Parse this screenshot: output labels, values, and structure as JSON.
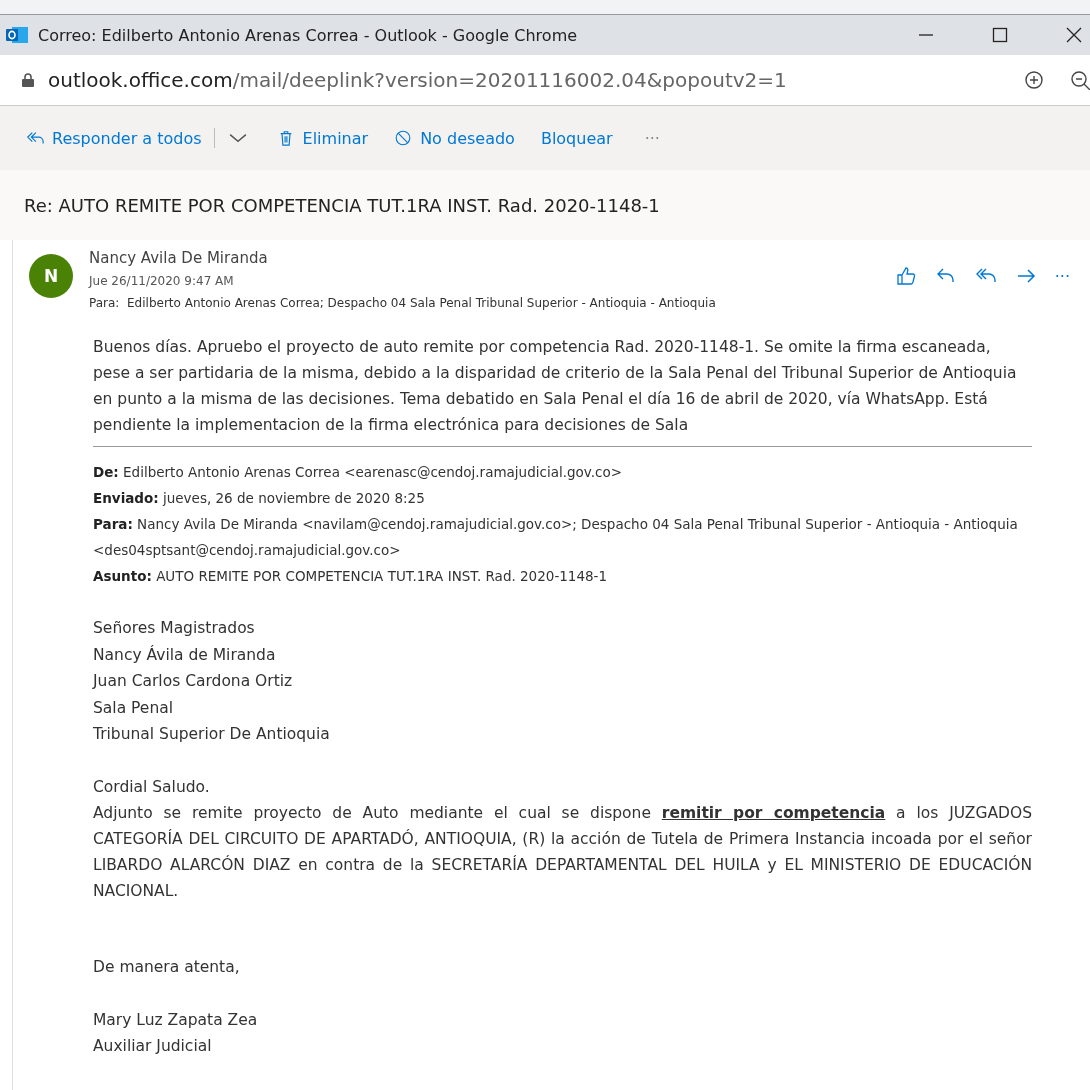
{
  "window": {
    "title": "Correo: Edilberto Antonio Arenas Correa - Outlook - Google Chrome"
  },
  "address_bar": {
    "host": "outlook.office.com",
    "path": "/mail/deeplink?version=20201116002.04&popoutv2=1"
  },
  "toolbar": [
    {
      "kind": "reply-all",
      "label": "Responder a todos"
    },
    {
      "kind": "dropdown"
    },
    {
      "kind": "delete",
      "label": "Eliminar"
    },
    {
      "kind": "junk",
      "label": "No deseado"
    },
    {
      "kind": "block",
      "label": "Bloquear"
    },
    {
      "kind": "more",
      "label": "···"
    }
  ],
  "subject": "Re: AUTO REMITE POR COMPETENCIA TUT.1RA INST. Rad. 2020-1148-1",
  "message": {
    "avatar": "N",
    "color": "#498205",
    "sender": "Nancy Avila De Miranda",
    "date": "Jue 26/11/2020 9:47 AM",
    "to_label": "Para:",
    "to": "Edilberto Antonio Arenas Correa; Despacho 04 Sala Penal Tribunal Superior - Antioquia - Antioquia",
    "actions": [
      {
        "kind": "like"
      },
      {
        "kind": "reply"
      },
      {
        "kind": "reply-all"
      },
      {
        "kind": "forward"
      },
      {
        "kind": "more",
        "label": "···"
      }
    ],
    "body": "Buenos días. Apruebo el proyecto de auto remite por competencia Rad. 2020-1148-1. Se omite la firma escaneada, pese a ser partidaria de la misma, debido a la disparidad de criterio de la Sala Penal del Tribunal Superior de Antioquia en punto a la misma de las decisiones. Tema debatido en Sala Penal el día 16 de abril de 2020, vía WhatsApp. Está pendiente la implementacion de la firma electrónica para decisiones de Sala",
    "quoted_header": [
      {
        "label": "De:",
        "value": "Edilberto Antonio Arenas Correa <earenasc@cendoj.ramajudicial.gov.co>"
      },
      {
        "label": "Enviado:",
        "value": "jueves, 26 de noviembre de 2020 8:25"
      },
      {
        "label": "Para:",
        "value": "Nancy Avila De Miranda <navilam@cendoj.ramajudicial.gov.co>; Despacho 04 Sala Penal Tribunal Superior - Antioquia - Antioquia <des04sptsant@cendoj.ramajudicial.gov.co>"
      },
      {
        "label": "Asunto:",
        "value": "AUTO REMITE POR COMPETENCIA TUT.1RA INST. Rad. 2020-1148-1"
      }
    ],
    "addressees": [
      "Señores Magistrados",
      "Nancy Ávila de Miranda",
      "Juan Carlos Cardona Ortiz",
      "Sala Penal",
      "Tribunal Superior De Antioquia"
    ],
    "greeting": "Cordial Saludo.",
    "paragraph": "Adjunto se remite proyecto de Auto mediante el cual se dispone **remitir por competencia** a los JUZGADOS CATEGORÍA DEL CIRCUITO DE APARTADÓ, ANTIOQUIA, (R) la acción de Tutela de Primera Instancia incoada por el señor LIBARDO ALARCÓN DIAZ en contra de la SECRETARÍA DEPARTAMENTAL DEL HUILA y EL MINISTERIO DE EDUCACIÓN NACIONAL.",
    "closing": "De manera atenta,",
    "signature": [
      "Mary Luz Zapata Zea",
      "Auxiliar Judicial"
    ]
  }
}
